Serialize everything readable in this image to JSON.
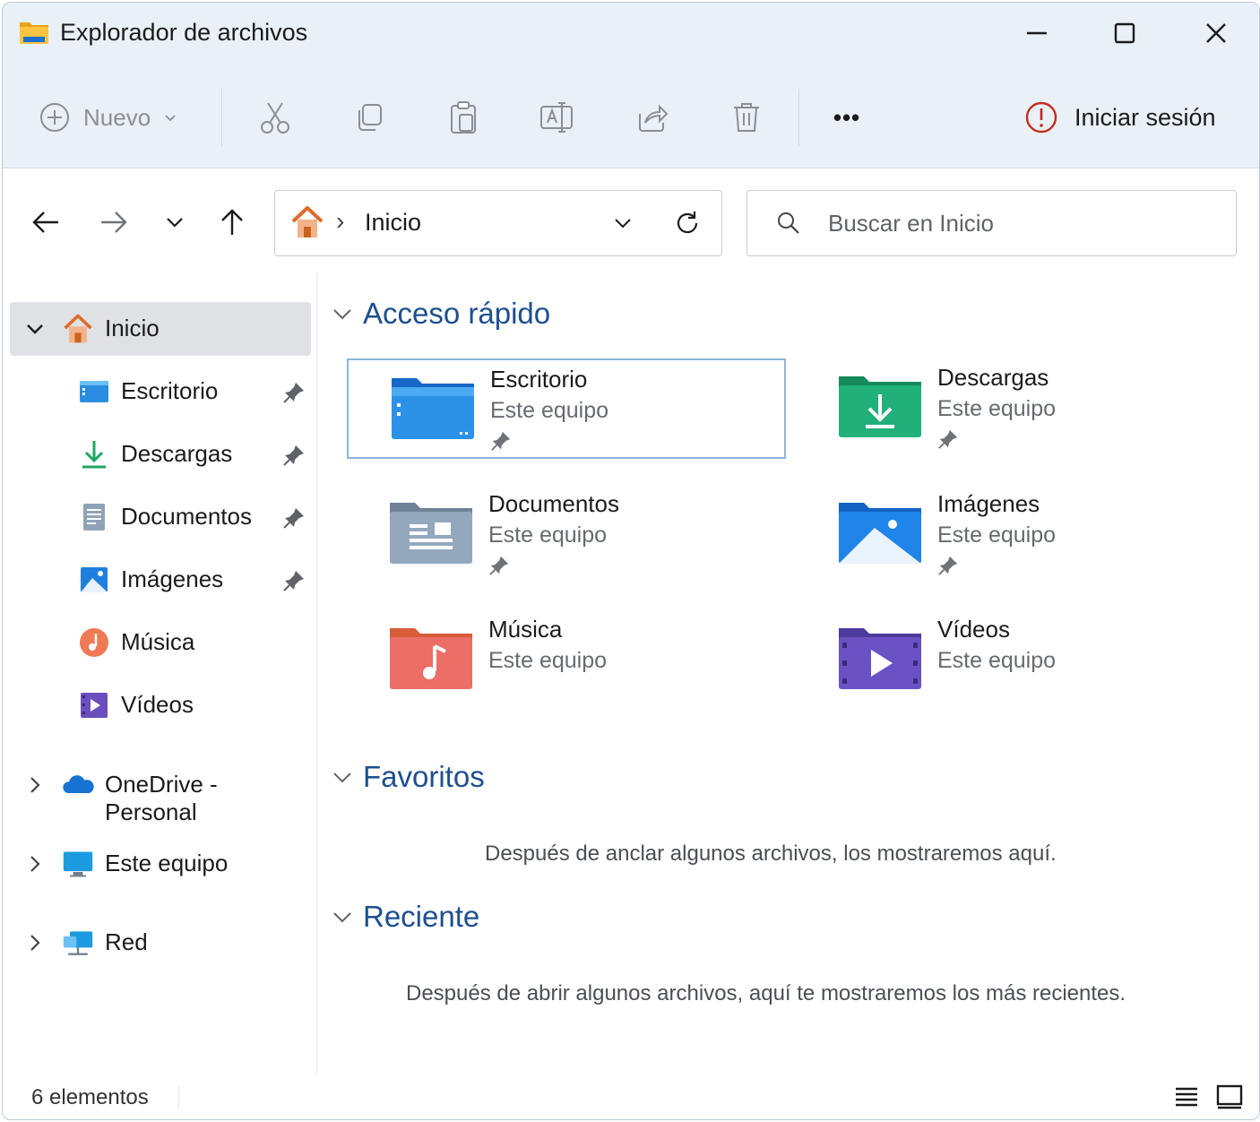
{
  "window": {
    "title": "Explorador de archivos",
    "minimize_icon": "minimize-icon",
    "maximize_icon": "maximize-icon",
    "close_icon": "close-icon"
  },
  "commandbar": {
    "new_label": "Nuevo",
    "more_label": "•••",
    "signin_label": "Iniciar sesión",
    "icons": [
      "add-circle-icon",
      "cut-icon",
      "copy-icon",
      "paste-icon",
      "rename-icon",
      "share-icon",
      "delete-icon",
      "more-icon",
      "alert-icon"
    ]
  },
  "navigation": {
    "breadcrumb_separator": "›",
    "location": "Inicio",
    "search_placeholder": "Buscar en Inicio",
    "icons": [
      "back-arrow-icon",
      "forward-arrow-icon",
      "recent-chevron-icon",
      "up-arrow-icon",
      "home-icon",
      "address-dropdown-icon",
      "refresh-icon",
      "search-icon"
    ]
  },
  "sidebar": {
    "home": {
      "label": "Inicio",
      "expanded": true
    },
    "pinned": [
      {
        "label": "Escritorio",
        "icon": "desktop-icon",
        "pinned": true
      },
      {
        "label": "Descargas",
        "icon": "download-icon",
        "pinned": true
      },
      {
        "label": "Documentos",
        "icon": "documents-icon",
        "pinned": true
      },
      {
        "label": "Imágenes",
        "icon": "pictures-icon",
        "pinned": true
      },
      {
        "label": "Música",
        "icon": "music-icon",
        "pinned": false
      },
      {
        "label": "Vídeos",
        "icon": "videos-icon",
        "pinned": false
      }
    ],
    "roots": [
      {
        "label": "OneDrive - Personal",
        "icon": "onedrive-cloud-icon"
      },
      {
        "label": "Este equipo",
        "icon": "this-pc-icon"
      },
      {
        "label": "Red",
        "icon": "network-icon"
      }
    ]
  },
  "main": {
    "quick_access": {
      "title": "Acceso rápido",
      "items": [
        {
          "name": "Escritorio",
          "location": "Este equipo",
          "pinned": true,
          "selected": true
        },
        {
          "name": "Descargas",
          "location": "Este equipo",
          "pinned": true
        },
        {
          "name": "Documentos",
          "location": "Este equipo",
          "pinned": true
        },
        {
          "name": "Imágenes",
          "location": "Este equipo",
          "pinned": true
        },
        {
          "name": "Música",
          "location": "Este equipo",
          "pinned": false
        },
        {
          "name": "Vídeos",
          "location": "Este equipo",
          "pinned": false
        }
      ]
    },
    "favorites": {
      "title": "Favoritos",
      "empty_message": "Después de anclar algunos archivos, los mostraremos aquí."
    },
    "recent": {
      "title": "Reciente",
      "empty_message": "Después de abrir algunos archivos, aquí te mostraremos los más recientes."
    }
  },
  "statusbar": {
    "item_count": "6 elementos",
    "icons": [
      "details-view-icon",
      "tiles-view-icon"
    ]
  },
  "colors": {
    "accent": "#1e4f8f",
    "title_band": "#e9f0f8",
    "selection": "#dfe1e4",
    "tile_border": "#8fb4dc",
    "alert": "#c42b1c"
  }
}
